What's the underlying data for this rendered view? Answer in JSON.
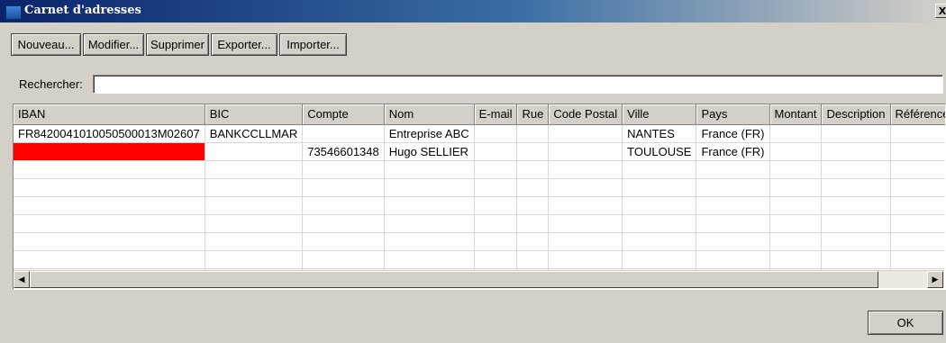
{
  "window": {
    "title": "Carnet d'adresses",
    "close_label": "X"
  },
  "toolbar": {
    "buttons": [
      "Nouveau...",
      "Modifier...",
      "Supprimer",
      "Exporter...",
      "Importer..."
    ]
  },
  "search": {
    "label": "Rechercher:",
    "value": ""
  },
  "table": {
    "columns": [
      "IBAN",
      "BIC",
      "Compte",
      "Nom",
      "E-mail",
      "Rue",
      "Code Postal",
      "Ville",
      "Pays",
      "Montant",
      "Description",
      "Référence"
    ],
    "rows": [
      [
        "FR8420041010050500013M02607",
        "BANKCCLLMAR",
        "",
        "Entreprise ABC",
        "",
        "",
        "",
        "NANTES",
        "France (FR)",
        "",
        "",
        ""
      ],
      [
        "",
        "",
        "73546601348",
        "Hugo SELLIER",
        "",
        "",
        "",
        "TOULOUSE",
        "France (FR)",
        "",
        "",
        ""
      ]
    ],
    "highlight_color": "#ff0000"
  },
  "scrollbar": {
    "left_arrow": "◀",
    "right_arrow": "▶"
  },
  "footer": {
    "ok_label": "OK"
  },
  "colors": {
    "titlebar_start": "#0a246a",
    "titlebar_end": "#d4d0c8",
    "face": "#d4d0c8"
  }
}
